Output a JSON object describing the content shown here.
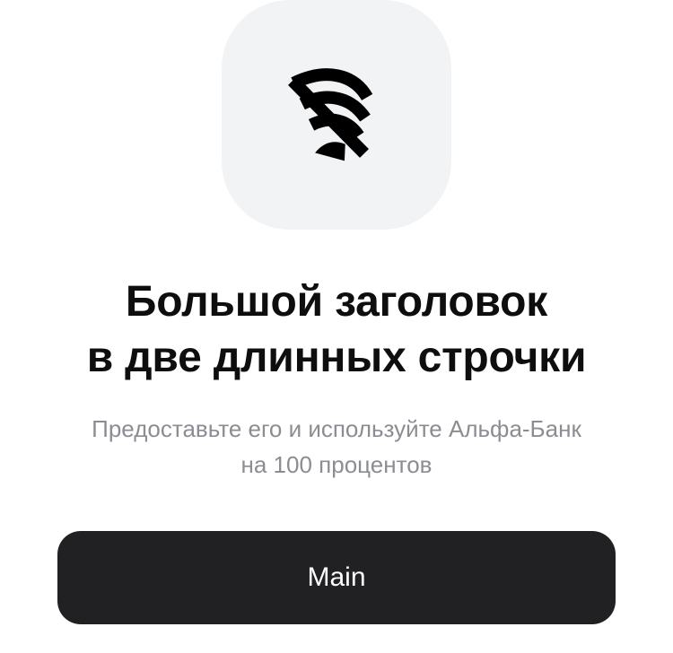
{
  "icon": {
    "name": "wifi-off-icon",
    "tile_color": "#f2f3f5",
    "glyph_color": "#000000"
  },
  "content": {
    "title_line_1": "Большой заголовок",
    "title_line_2": "в две длинных строчки",
    "subtitle_line_1": "Предоставьте его и используйте Альфа-Банк",
    "subtitle_line_2": "на 100 процентов"
  },
  "actions": {
    "main_label": "Main"
  },
  "colors": {
    "title": "#0e0e0e",
    "subtitle": "#8b8d93",
    "button_background": "#212124",
    "button_text": "#ffffff"
  }
}
